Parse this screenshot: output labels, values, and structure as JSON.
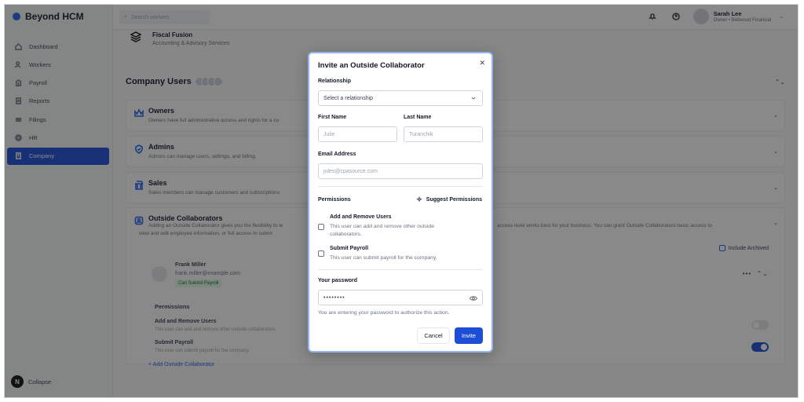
{
  "app": {
    "name": "Beyond HCM"
  },
  "sidebar": {
    "items": [
      {
        "label": "Dashboard",
        "icon": "home-icon"
      },
      {
        "label": "Workers",
        "icon": "users-icon"
      },
      {
        "label": "Payroll",
        "icon": "bank-icon"
      },
      {
        "label": "Reports",
        "icon": "report-icon"
      },
      {
        "label": "Filings",
        "icon": "filings-icon"
      },
      {
        "label": "HR",
        "icon": "gear-icon"
      },
      {
        "label": "Company",
        "icon": "building-icon",
        "active": true
      }
    ],
    "collapse_badge": "N",
    "collapse_label": "Collapse"
  },
  "topbar": {
    "search_placeholder": "Search workers",
    "user_name": "Sarah Lee",
    "user_role": "Owner • Beltwood Financial"
  },
  "main": {
    "company_name": "Fiscal Fusion",
    "company_sub": "Accounting & Advisory Services",
    "section_title": "Company Users",
    "roles": [
      {
        "title": "Owners",
        "desc": "Owners have full administrative access and rights for a co"
      },
      {
        "title": "Admins",
        "desc": "Admins can manage users, settings, and billing."
      },
      {
        "title": "Sales",
        "desc": "Sales members can manage customers and subscriptions."
      }
    ],
    "oc": {
      "title": "Outside Collaborators",
      "desc1": "Adding an Outside Collaborator gives you the flexibility to le",
      "desc2": "view and edit employee information, or full access to submi",
      "desc_right": "access level works best for your business. You can grant Outside Collaborators basic access to",
      "include_archived": "Include Archived",
      "member_name": "Frank Miller",
      "member_email": "frank.miller@example.com",
      "member_badge": "Can Submit Payroll",
      "perm_heading": "Permissions",
      "perm1_title": "Add and Remove Users",
      "perm1_desc": "This user can add and remove other outside collaborators.",
      "perm1_on": false,
      "perm2_title": "Submit Payroll",
      "perm2_desc": "This user can submit payroll for the company.",
      "perm2_on": true,
      "add_link": "+ Add Outside Collaborator"
    }
  },
  "modal": {
    "title": "Invite an Outside Collaborator",
    "relationship_label": "Relationship",
    "relationship_placeholder": "Select a relationship",
    "first_name_label": "First Name",
    "first_name_value": "Julie",
    "last_name_label": "Last Name",
    "last_name_value": "Turanchik",
    "email_label": "Email Address",
    "email_value": "jules@cpasource.com",
    "permissions_label": "Permissions",
    "suggest_label": "Suggest Permissions",
    "perm1_title": "Add and Remove Users",
    "perm1_desc": "This user can add and remove other outside collaborators.",
    "perm2_title": "Submit Payroll",
    "perm2_desc": "This user can submit payroll for the company.",
    "password_label": "Your password",
    "password_value": "••••••••",
    "password_hint": "You are entering your password to authorize this action.",
    "cancel_label": "Cancel",
    "invite_label": "Invite"
  },
  "colors": {
    "accent": "#1d4ed8",
    "overlay": "rgba(20,20,20,0.5)",
    "modal_border": "#93b4f0"
  }
}
